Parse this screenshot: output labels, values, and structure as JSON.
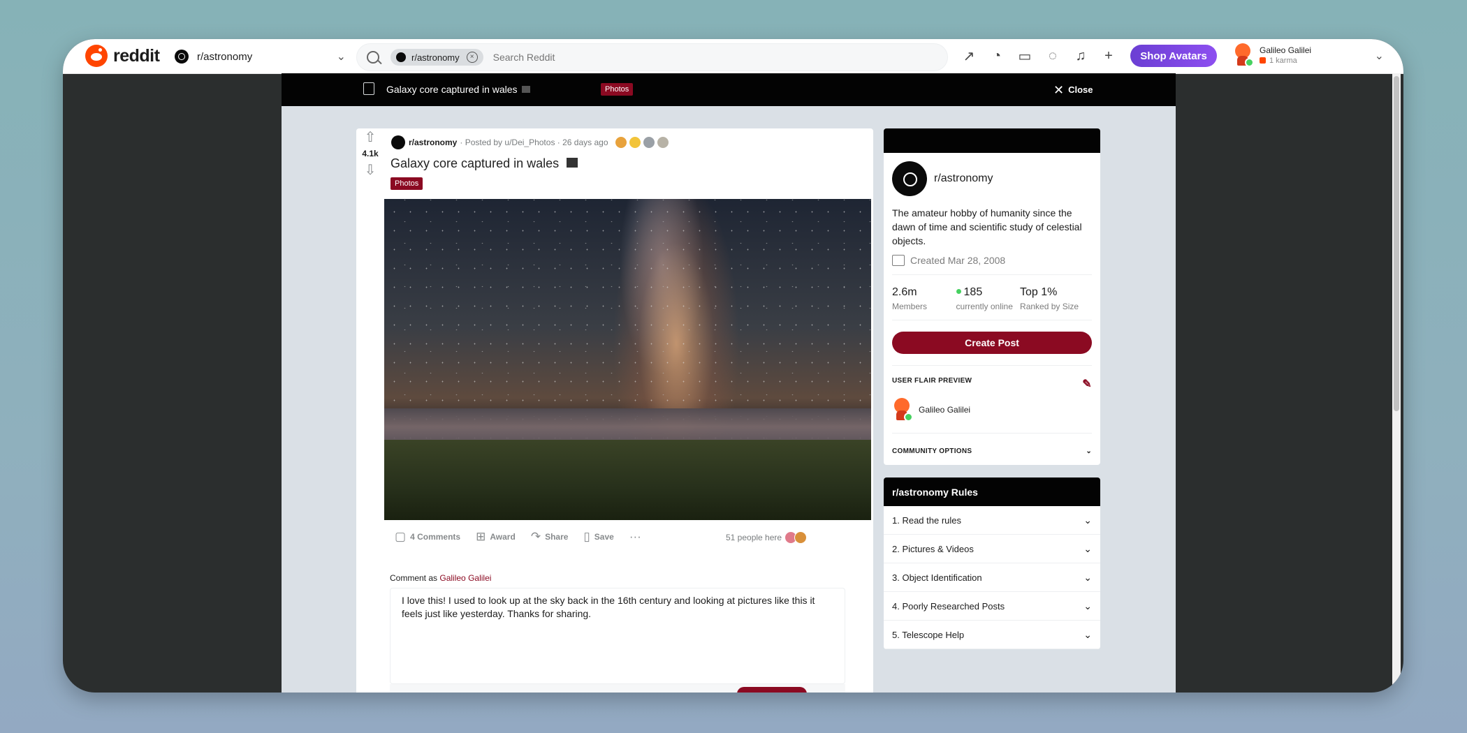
{
  "topbar": {
    "logo_text": "reddit",
    "community": "r/astronomy",
    "search_chip": "r/astronomy",
    "search_placeholder": "Search Reddit",
    "shop_label": "Shop Avatars",
    "user_name": "Galileo Galilei",
    "user_karma": "1 karma"
  },
  "post_header": {
    "title": "Galaxy core captured in wales",
    "flair": "Photos",
    "close_label": "Close"
  },
  "post": {
    "votes": "4.1k",
    "subreddit": "r/astronomy",
    "posted_by": "· Posted by u/Dei_Photos · 26 days ago",
    "title": "Galaxy core captured in wales",
    "flair": "Photos",
    "actions": {
      "comments": "4 Comments",
      "award": "Award",
      "share": "Share",
      "save": "Save"
    },
    "people_here": "51 people here",
    "comment_as_prefix": "Comment as",
    "comment_as_user": "Galileo Galilei",
    "comment_text": "I love this! I used to look up at the sky back in the 16th century and looking at pictures like this it feels just like yesterday. Thanks for sharing."
  },
  "sidebar": {
    "community_name": "r/astronomy",
    "description": "The amateur hobby of humanity since the dawn of time and scientific study of celestial objects.",
    "created": "Created Mar 28, 2008",
    "stats": [
      {
        "num": "2.6m",
        "label": "Members"
      },
      {
        "num": "185",
        "label": "currently online"
      },
      {
        "num": "Top 1%",
        "label": "Ranked by Size"
      }
    ],
    "create_post": "Create Post",
    "flair_preview_title": "USER FLAIR PREVIEW",
    "flair_user": "Galileo Galilei",
    "community_options": "COMMUNITY OPTIONS",
    "rules_title": "r/astronomy Rules",
    "rules": [
      "1. Read the rules",
      "2. Pictures & Videos",
      "3. Object Identification",
      "4. Poorly Researched Posts",
      "5. Telescope Help"
    ]
  },
  "colors": {
    "brand": "#ff4500",
    "accent": "#8b0a22",
    "shop": "#7a4ae0",
    "online": "#46d160"
  }
}
